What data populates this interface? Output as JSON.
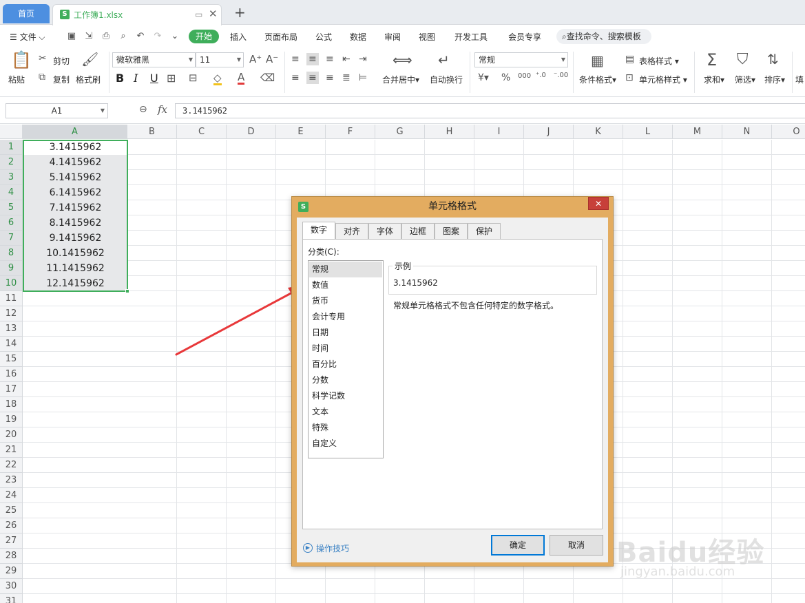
{
  "tabs": {
    "home": "首页",
    "file": "工作簿1.xlsx"
  },
  "menu": {
    "file": "文件",
    "start": "开始",
    "items": [
      "插入",
      "页面布局",
      "公式",
      "数据",
      "审阅",
      "视图",
      "开发工具",
      "会员专享"
    ],
    "search": "查找命令、搜索模板"
  },
  "ribbon": {
    "paste": "粘贴",
    "cut": "剪切",
    "copy": "复制",
    "format_painter": "格式刷",
    "font_name": "微软雅黑",
    "font_size": "11",
    "merge_center": "合并居中",
    "auto_wrap": "自动换行",
    "number_format": "常规",
    "conditional_format": "条件格式",
    "table_style": "表格样式",
    "cell_style": "单元格样式",
    "sum": "求和",
    "filter": "筛选",
    "sort": "排序",
    "fill": "填"
  },
  "formula": {
    "namebox": "A1",
    "value": "3.1415962"
  },
  "grid": {
    "columns": [
      "A",
      "B",
      "C",
      "D",
      "E",
      "F",
      "G",
      "H",
      "I",
      "J",
      "K",
      "L",
      "M",
      "N",
      "O"
    ],
    "rows": [
      "1",
      "2",
      "3",
      "4",
      "5",
      "6",
      "7",
      "8",
      "9",
      "10",
      "11",
      "12",
      "13",
      "14",
      "15",
      "16",
      "17",
      "18",
      "19",
      "20",
      "21",
      "22",
      "23",
      "24",
      "25",
      "26",
      "27",
      "28",
      "29",
      "30",
      "31"
    ],
    "cells_a": [
      "3.1415962",
      "4.1415962",
      "5.1415962",
      "6.1415962",
      "7.1415962",
      "8.1415962",
      "9.1415962",
      "10.1415962",
      "11.1415962",
      "12.1415962"
    ]
  },
  "dialog": {
    "title": "单元格格式",
    "tabs": [
      "数字",
      "对齐",
      "字体",
      "边框",
      "图案",
      "保护"
    ],
    "category_label": "分类(C):",
    "categories": [
      "常规",
      "数值",
      "货币",
      "会计专用",
      "日期",
      "时间",
      "百分比",
      "分数",
      "科学记数",
      "文本",
      "特殊",
      "自定义"
    ],
    "sample_label": "示例",
    "sample_value": "3.1415962",
    "description": "常规单元格格式不包含任何特定的数字格式。",
    "tips": "操作技巧",
    "ok": "确定",
    "cancel": "取消"
  },
  "watermark": {
    "text": "Baidu经验",
    "sub": "jingyan.baidu.com"
  },
  "colors": {
    "accent": "#3fae5b",
    "tab_blue": "#4d8fe0",
    "dialog_frame": "#e3ac60",
    "arrow": "#e8383a"
  }
}
